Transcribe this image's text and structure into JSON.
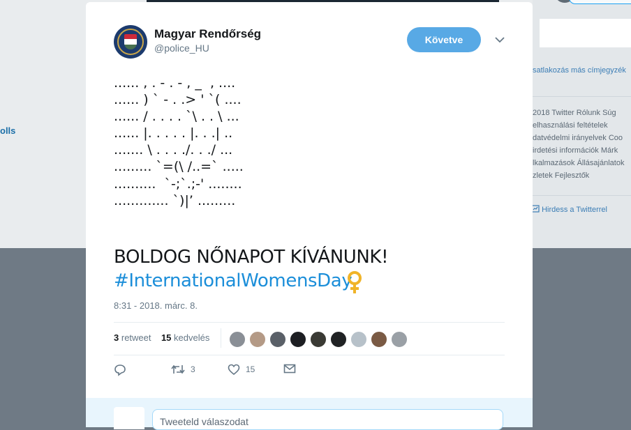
{
  "background": {
    "left_link": "olls",
    "sidebar": {
      "connect_text": "satlakozás más címjegyzék",
      "footer_lines": [
        "2018 Twitter  Rólunk  Súg",
        "elhasználási feltételek",
        "datvédelmi irányelvek  Coo",
        "irdetési információk  Márk",
        "lkalmazások  Állásajánlatok",
        "zletek  Fejlesztők"
      ],
      "advertise_label": "Hirdess a Twitterrel"
    }
  },
  "tweet": {
    "author": {
      "name": "Magyar Rendőrség",
      "handle": "@police_HU"
    },
    "follow_label": "Követve",
    "ascii_art": [
      "...... , . - . - , _  , ....",
      "...... ) ` - . .> ' `( ....",
      "...... / . . . . `\\ . . \\ ...",
      "...... |. . . . . |. . .| ..",
      "....... \\ . . . ./. . ./ ...",
      "......... `=(\\ /..=` .....",
      "..........  `-;`.;-' ........",
      "............. `)|’ ........."
    ],
    "headline": "BOLDOG NŐNAPOT KÍVÁNUNK!",
    "hashtag": "#InternationalWomensDay",
    "timestamp": "8:31 - 2018. márc. 8.",
    "stats": {
      "retweet_count": "3",
      "retweet_label": "retweet",
      "like_count": "15",
      "like_label": "kedvelés"
    },
    "liker_colors": [
      "#8a8f96",
      "#b49a86",
      "#5a6068",
      "#1d1f23",
      "#3a3a34",
      "#202224",
      "#b7c1c9",
      "#7a5a44",
      "#9aa0a6"
    ],
    "actions": {
      "retweets": "3",
      "likes": "15"
    }
  },
  "reply": {
    "placeholder": "Tweeteld válaszodat"
  },
  "colors": {
    "accent": "#1da1f2",
    "hashtag": "#1b8ed9",
    "follow_bg": "#58a9e5",
    "venus": "#f0b429"
  }
}
